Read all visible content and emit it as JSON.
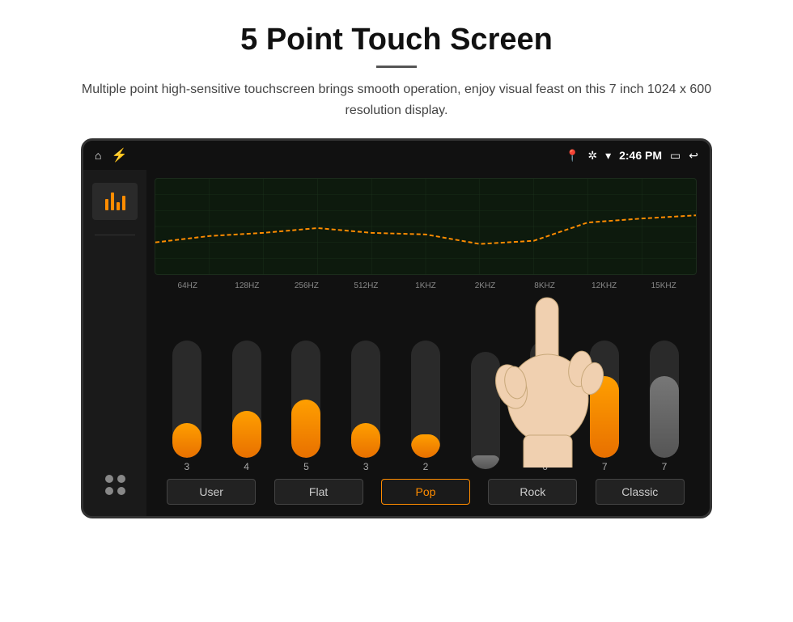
{
  "header": {
    "title": "5 Point Touch Screen",
    "subtitle": "Multiple point high-sensitive touchscreen brings smooth operation, enjoy visual feast on this 7 inch 1024 x 600 resolution display."
  },
  "statusBar": {
    "time": "2:46 PM",
    "icons": {
      "home": "⌂",
      "usb": "⚡",
      "location": "📍",
      "bluetooth": "⚡",
      "wifi": "▾",
      "battery": "🔋",
      "back": "↩"
    }
  },
  "sidebar": {
    "eqLabel": "EQ",
    "dotsLabel": "Menu"
  },
  "equalizer": {
    "frequencies": [
      "64HZ",
      "128HZ",
      "256HZ",
      "512HZ",
      "1KHZ",
      "2KHZ",
      "8KHZ",
      "12KHZ",
      "15KHZ"
    ],
    "values": [
      3,
      4,
      5,
      3,
      2,
      1,
      6,
      7,
      7
    ],
    "maxValue": 10,
    "presets": [
      "User",
      "Flat",
      "Pop",
      "Rock",
      "Classic"
    ],
    "activePreset": "Pop"
  }
}
